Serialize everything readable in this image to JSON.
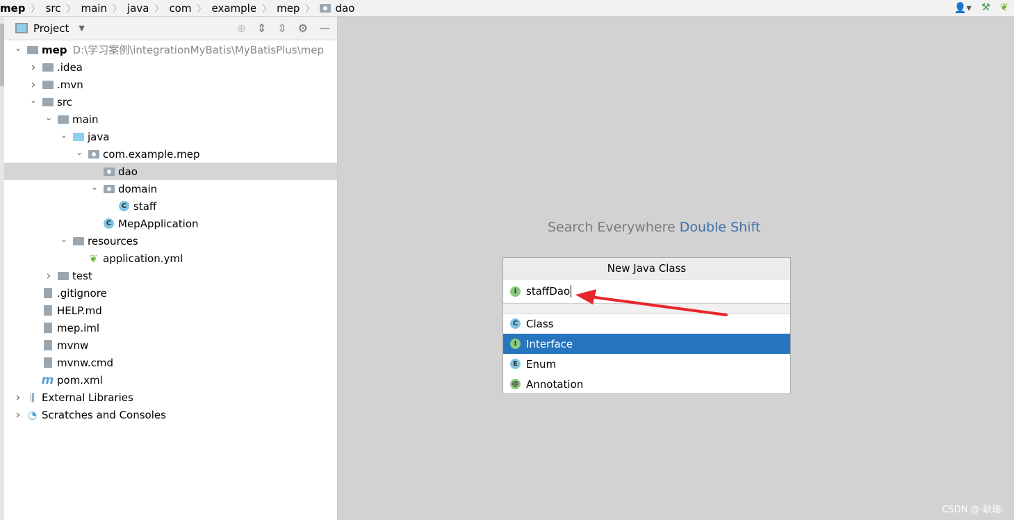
{
  "breadcrumb": [
    "mep",
    "src",
    "main",
    "java",
    "com",
    "example",
    "mep",
    "dao"
  ],
  "panel": {
    "title": "Project"
  },
  "tree": [
    {
      "level": 0,
      "chev": "down",
      "icon": "module-folder",
      "label": "mep",
      "path": "D:\\学习案例\\integrationMyBatis\\MyBatisPlus\\mep",
      "bold": true
    },
    {
      "level": 1,
      "chev": "right",
      "icon": "folder",
      "label": ".idea"
    },
    {
      "level": 1,
      "chev": "right",
      "icon": "folder",
      "label": ".mvn"
    },
    {
      "level": 1,
      "chev": "down",
      "icon": "folder",
      "label": "src"
    },
    {
      "level": 2,
      "chev": "down",
      "icon": "folder",
      "label": "main"
    },
    {
      "level": 3,
      "chev": "down",
      "icon": "source-folder",
      "label": "java"
    },
    {
      "level": 4,
      "chev": "down",
      "icon": "package",
      "label": "com.example.mep"
    },
    {
      "level": 5,
      "chev": "",
      "icon": "package",
      "label": "dao",
      "selected": true
    },
    {
      "level": 5,
      "chev": "down",
      "icon": "package",
      "label": "domain"
    },
    {
      "level": 6,
      "chev": "",
      "icon": "class",
      "label": "staff"
    },
    {
      "level": 5,
      "chev": "",
      "icon": "spring-app-class",
      "label": "MepApplication"
    },
    {
      "level": 3,
      "chev": "down",
      "icon": "resources-folder",
      "label": "resources"
    },
    {
      "level": 4,
      "chev": "",
      "icon": "spring-yml",
      "label": "application.yml"
    },
    {
      "level": 2,
      "chev": "right",
      "icon": "folder",
      "label": "test"
    },
    {
      "level": 1,
      "chev": "",
      "icon": "gitignore-file",
      "label": ".gitignore"
    },
    {
      "level": 1,
      "chev": "",
      "icon": "markdown-file",
      "label": "HELP.md"
    },
    {
      "level": 1,
      "chev": "",
      "icon": "iml-file",
      "label": "mep.iml"
    },
    {
      "level": 1,
      "chev": "",
      "icon": "shell-file",
      "label": "mvnw"
    },
    {
      "level": 1,
      "chev": "",
      "icon": "text-file",
      "label": "mvnw.cmd"
    },
    {
      "level": 1,
      "chev": "",
      "icon": "maven-file",
      "label": "pom.xml"
    },
    {
      "level": 0,
      "chev": "right",
      "icon": "libraries",
      "label": "External Libraries"
    },
    {
      "level": 0,
      "chev": "right",
      "icon": "scratches",
      "label": "Scratches and Consoles"
    }
  ],
  "hint": {
    "text": "Search Everywhere",
    "shortcut": "Double Shift"
  },
  "dialog": {
    "title": "New Java Class",
    "input_value": "staffDao",
    "options": [
      {
        "label": "Class",
        "letter": "C",
        "color": "#7fc4e2"
      },
      {
        "label": "Interface",
        "letter": "I",
        "color": "#8cc97f",
        "selected": true
      },
      {
        "label": "Enum",
        "letter": "E",
        "color": "#7fc4e2"
      },
      {
        "label": "Annotation",
        "letter": "@",
        "color": "#8cc97f"
      }
    ]
  },
  "watermark": "CSDN @-耿瑞-",
  "colors": {
    "selection": "#2675bf",
    "arrow": "#e8262a"
  }
}
